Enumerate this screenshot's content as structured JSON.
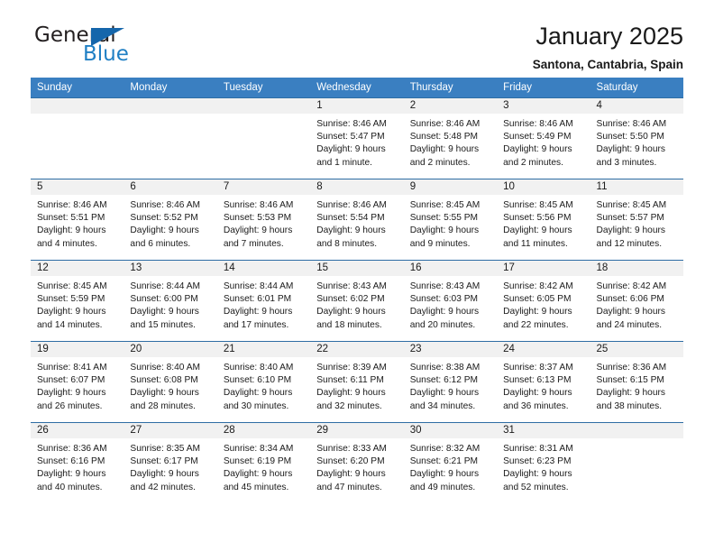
{
  "brand": {
    "name_top": "General",
    "name_bottom": "Blue",
    "accent_color": "#1566ab",
    "text_color": "#231f20"
  },
  "header": {
    "title": "January 2025",
    "subtitle": "Santona, Cantabria, Spain"
  },
  "calendar": {
    "header_bg": "#3a7fc1",
    "row_divider_color": "#2e6da4",
    "daynum_band_color": "#f1f1f1",
    "weekday_headers": [
      "Sunday",
      "Monday",
      "Tuesday",
      "Wednesday",
      "Thursday",
      "Friday",
      "Saturday"
    ],
    "weeks": [
      [
        {
          "day": "",
          "lines": []
        },
        {
          "day": "",
          "lines": []
        },
        {
          "day": "",
          "lines": []
        },
        {
          "day": "1",
          "lines": [
            "Sunrise: 8:46 AM",
            "Sunset: 5:47 PM",
            "Daylight: 9 hours",
            "and 1 minute."
          ]
        },
        {
          "day": "2",
          "lines": [
            "Sunrise: 8:46 AM",
            "Sunset: 5:48 PM",
            "Daylight: 9 hours",
            "and 2 minutes."
          ]
        },
        {
          "day": "3",
          "lines": [
            "Sunrise: 8:46 AM",
            "Sunset: 5:49 PM",
            "Daylight: 9 hours",
            "and 2 minutes."
          ]
        },
        {
          "day": "4",
          "lines": [
            "Sunrise: 8:46 AM",
            "Sunset: 5:50 PM",
            "Daylight: 9 hours",
            "and 3 minutes."
          ]
        }
      ],
      [
        {
          "day": "5",
          "lines": [
            "Sunrise: 8:46 AM",
            "Sunset: 5:51 PM",
            "Daylight: 9 hours",
            "and 4 minutes."
          ]
        },
        {
          "day": "6",
          "lines": [
            "Sunrise: 8:46 AM",
            "Sunset: 5:52 PM",
            "Daylight: 9 hours",
            "and 6 minutes."
          ]
        },
        {
          "day": "7",
          "lines": [
            "Sunrise: 8:46 AM",
            "Sunset: 5:53 PM",
            "Daylight: 9 hours",
            "and 7 minutes."
          ]
        },
        {
          "day": "8",
          "lines": [
            "Sunrise: 8:46 AM",
            "Sunset: 5:54 PM",
            "Daylight: 9 hours",
            "and 8 minutes."
          ]
        },
        {
          "day": "9",
          "lines": [
            "Sunrise: 8:45 AM",
            "Sunset: 5:55 PM",
            "Daylight: 9 hours",
            "and 9 minutes."
          ]
        },
        {
          "day": "10",
          "lines": [
            "Sunrise: 8:45 AM",
            "Sunset: 5:56 PM",
            "Daylight: 9 hours",
            "and 11 minutes."
          ]
        },
        {
          "day": "11",
          "lines": [
            "Sunrise: 8:45 AM",
            "Sunset: 5:57 PM",
            "Daylight: 9 hours",
            "and 12 minutes."
          ]
        }
      ],
      [
        {
          "day": "12",
          "lines": [
            "Sunrise: 8:45 AM",
            "Sunset: 5:59 PM",
            "Daylight: 9 hours",
            "and 14 minutes."
          ]
        },
        {
          "day": "13",
          "lines": [
            "Sunrise: 8:44 AM",
            "Sunset: 6:00 PM",
            "Daylight: 9 hours",
            "and 15 minutes."
          ]
        },
        {
          "day": "14",
          "lines": [
            "Sunrise: 8:44 AM",
            "Sunset: 6:01 PM",
            "Daylight: 9 hours",
            "and 17 minutes."
          ]
        },
        {
          "day": "15",
          "lines": [
            "Sunrise: 8:43 AM",
            "Sunset: 6:02 PM",
            "Daylight: 9 hours",
            "and 18 minutes."
          ]
        },
        {
          "day": "16",
          "lines": [
            "Sunrise: 8:43 AM",
            "Sunset: 6:03 PM",
            "Daylight: 9 hours",
            "and 20 minutes."
          ]
        },
        {
          "day": "17",
          "lines": [
            "Sunrise: 8:42 AM",
            "Sunset: 6:05 PM",
            "Daylight: 9 hours",
            "and 22 minutes."
          ]
        },
        {
          "day": "18",
          "lines": [
            "Sunrise: 8:42 AM",
            "Sunset: 6:06 PM",
            "Daylight: 9 hours",
            "and 24 minutes."
          ]
        }
      ],
      [
        {
          "day": "19",
          "lines": [
            "Sunrise: 8:41 AM",
            "Sunset: 6:07 PM",
            "Daylight: 9 hours",
            "and 26 minutes."
          ]
        },
        {
          "day": "20",
          "lines": [
            "Sunrise: 8:40 AM",
            "Sunset: 6:08 PM",
            "Daylight: 9 hours",
            "and 28 minutes."
          ]
        },
        {
          "day": "21",
          "lines": [
            "Sunrise: 8:40 AM",
            "Sunset: 6:10 PM",
            "Daylight: 9 hours",
            "and 30 minutes."
          ]
        },
        {
          "day": "22",
          "lines": [
            "Sunrise: 8:39 AM",
            "Sunset: 6:11 PM",
            "Daylight: 9 hours",
            "and 32 minutes."
          ]
        },
        {
          "day": "23",
          "lines": [
            "Sunrise: 8:38 AM",
            "Sunset: 6:12 PM",
            "Daylight: 9 hours",
            "and 34 minutes."
          ]
        },
        {
          "day": "24",
          "lines": [
            "Sunrise: 8:37 AM",
            "Sunset: 6:13 PM",
            "Daylight: 9 hours",
            "and 36 minutes."
          ]
        },
        {
          "day": "25",
          "lines": [
            "Sunrise: 8:36 AM",
            "Sunset: 6:15 PM",
            "Daylight: 9 hours",
            "and 38 minutes."
          ]
        }
      ],
      [
        {
          "day": "26",
          "lines": [
            "Sunrise: 8:36 AM",
            "Sunset: 6:16 PM",
            "Daylight: 9 hours",
            "and 40 minutes."
          ]
        },
        {
          "day": "27",
          "lines": [
            "Sunrise: 8:35 AM",
            "Sunset: 6:17 PM",
            "Daylight: 9 hours",
            "and 42 minutes."
          ]
        },
        {
          "day": "28",
          "lines": [
            "Sunrise: 8:34 AM",
            "Sunset: 6:19 PM",
            "Daylight: 9 hours",
            "and 45 minutes."
          ]
        },
        {
          "day": "29",
          "lines": [
            "Sunrise: 8:33 AM",
            "Sunset: 6:20 PM",
            "Daylight: 9 hours",
            "and 47 minutes."
          ]
        },
        {
          "day": "30",
          "lines": [
            "Sunrise: 8:32 AM",
            "Sunset: 6:21 PM",
            "Daylight: 9 hours",
            "and 49 minutes."
          ]
        },
        {
          "day": "31",
          "lines": [
            "Sunrise: 8:31 AM",
            "Sunset: 6:23 PM",
            "Daylight: 9 hours",
            "and 52 minutes."
          ]
        },
        {
          "day": "",
          "lines": []
        }
      ]
    ]
  }
}
